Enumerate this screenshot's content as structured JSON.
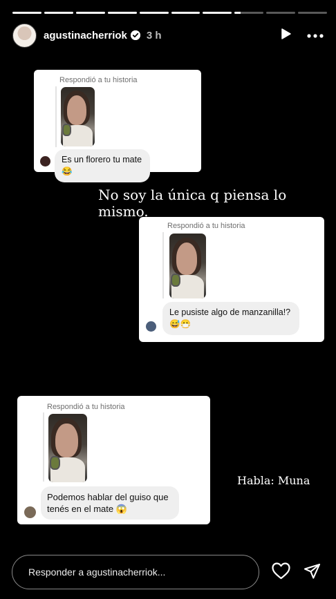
{
  "story": {
    "segments": [
      1,
      1,
      1,
      1,
      1,
      1,
      1,
      0.2,
      0,
      0
    ],
    "username": "agustinacherriok",
    "time": "3 h"
  },
  "cards": [
    {
      "replied_label": "Respondió a tu historia",
      "message": "Es un florero tu mate 😂",
      "avatar_color": "#3b2321"
    },
    {
      "replied_label": "Respondió a tu historia",
      "message": "Le pusiste algo de manzanilla!? 😅😷",
      "avatar_color": "#4b5e7a"
    },
    {
      "replied_label": "Respondió a tu historia",
      "message": "Podemos hablar del guiso que tenés en el mate 😱",
      "avatar_color": "#7a6a58"
    }
  ],
  "captions": {
    "main": "No soy la única q piensa lo mismo.",
    "speaker": "Habla: Muna"
  },
  "reply": {
    "placeholder": "Responder a agustinacherriok..."
  },
  "icons": {
    "play": "play-icon",
    "more": "more-options-icon",
    "like": "heart-icon",
    "share": "send-icon"
  }
}
